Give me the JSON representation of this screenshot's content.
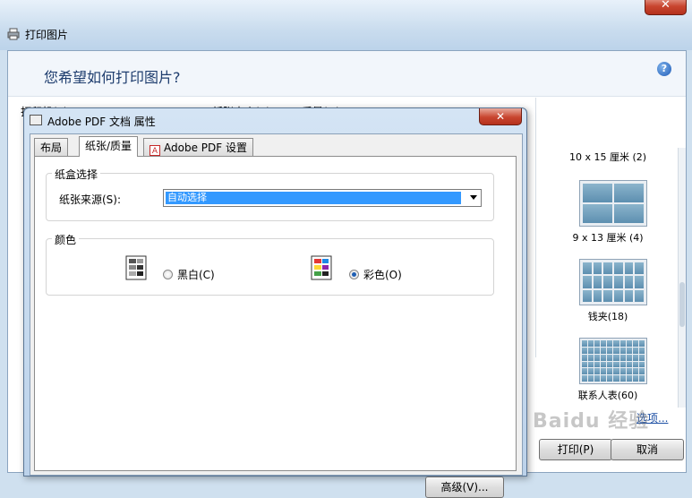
{
  "outer_window": {
    "title": "打印图片",
    "close_glyph": "✕",
    "question": "您希望如何打印图片?",
    "clipped_labels": [
      "打印机(P)",
      "纸张大小(S)",
      "质量(Q)"
    ],
    "help_glyph": "?",
    "layouts": [
      {
        "label": "10 x 15 厘米 (2)"
      },
      {
        "label": "9 x 13 厘米 (4)"
      },
      {
        "label": "钱夹(18)"
      },
      {
        "label": "联系人表(60)"
      }
    ],
    "options_link": "选项...",
    "print_button": "打印(P)",
    "cancel_button": "取消",
    "watermark": "Baidu 经验"
  },
  "dialog": {
    "title": "Adobe PDF 文档 属性",
    "close_glyph": "✕",
    "tabs": [
      {
        "label": "布局",
        "active": false
      },
      {
        "label": "纸张/质量",
        "active": true
      },
      {
        "label": "Adobe PDF 设置",
        "active": false
      }
    ],
    "tray_group": {
      "title": "纸盒选择",
      "source_label": "纸张来源(S):",
      "source_value": "自动选择"
    },
    "color_group": {
      "title": "颜色",
      "bw_label": "黑白(C)",
      "bw_selected": false,
      "color_label": "彩色(O)",
      "color_selected": true
    },
    "advanced_button": "高级(V)..."
  },
  "colors": {
    "selection": "#3399ff",
    "link": "#1b4ea3",
    "close_red": "#c8452f"
  }
}
